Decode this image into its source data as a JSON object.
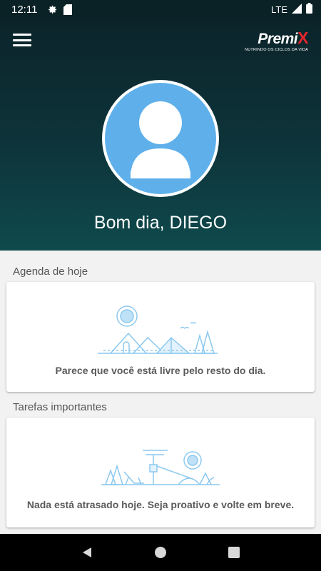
{
  "status_bar": {
    "time": "12:11",
    "network": "LTE"
  },
  "header": {
    "logo_brand": "Premi",
    "logo_x": "X",
    "logo_tagline": "NUTRINDO OS CICLOS DA VIDA",
    "greeting": "Bom dia, DIEGO"
  },
  "agenda": {
    "title": "Agenda de hoje",
    "message": "Parece que você está livre pelo resto do dia."
  },
  "tasks": {
    "title": "Tarefas importantes",
    "message": "Nada está atrasado hoje. Seja proativo e volte em breve."
  },
  "colors": {
    "header_dark": "#0b242a",
    "header_teal": "#0f4a4d",
    "avatar_blue": "#5fb0ea",
    "illustration_blue": "#8cc9ef",
    "logo_red": "#e2262d"
  },
  "icons": [
    "settings-icon",
    "sd-card-icon",
    "signal-icon",
    "battery-icon",
    "menu-icon",
    "back-icon",
    "home-icon",
    "recents-icon"
  ]
}
